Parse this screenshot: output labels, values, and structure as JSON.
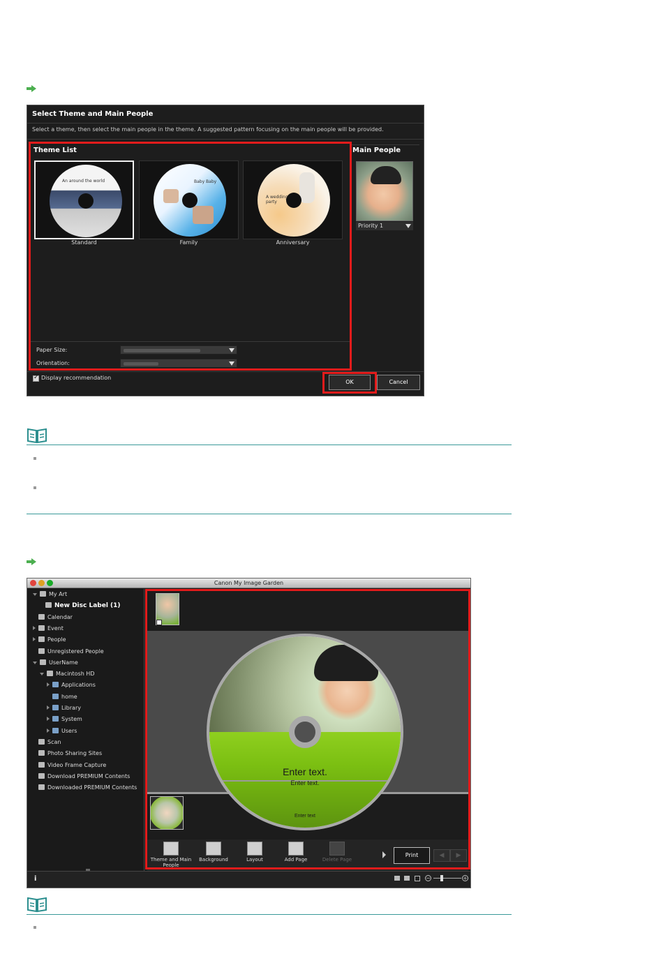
{
  "dialog": {
    "title": "Select Theme and Main People",
    "instruction": "Select a theme, then select the main people in the theme. A suggested pattern focusing on the main people will be provided.",
    "theme_list_label": "Theme List",
    "themes": [
      {
        "name": "Standard",
        "disc_text": "An around the world",
        "selected": true
      },
      {
        "name": "Family",
        "disc_text": "Baby Baby",
        "selected": false
      },
      {
        "name": "Anniversary",
        "disc_text": "A wedding party",
        "selected": false
      }
    ],
    "main_people_label": "Main People",
    "priority": "Priority 1",
    "paper_size_label": "Paper Size:",
    "orientation_label": "Orientation:",
    "display_recommendation": "Display recommendation",
    "ok_label": "OK",
    "cancel_label": "Cancel"
  },
  "app": {
    "window_title": "Canon My Image Garden",
    "sidebar": [
      {
        "label": "My Art",
        "level": 0,
        "expand": "down",
        "icon": "art-icon"
      },
      {
        "label": "New Disc Label (1)",
        "level": 1,
        "expand": "none",
        "icon": "disc-label-icon",
        "bold": true
      },
      {
        "label": "Calendar",
        "level": 0,
        "expand": "none",
        "icon": "calendar-icon"
      },
      {
        "label": "Event",
        "level": 0,
        "expand": "right",
        "icon": "event-icon"
      },
      {
        "label": "People",
        "level": 0,
        "expand": "right",
        "icon": "people-icon"
      },
      {
        "label": "Unregistered People",
        "level": 0,
        "expand": "none",
        "icon": "person-icon"
      },
      {
        "label": "UserName",
        "level": 0,
        "expand": "down",
        "icon": "computer-icon"
      },
      {
        "label": "Macintosh HD",
        "level": 1,
        "expand": "down",
        "icon": "drive-icon"
      },
      {
        "label": "Applications",
        "level": 2,
        "expand": "right",
        "icon": "folder-icon"
      },
      {
        "label": "home",
        "level": 2,
        "expand": "none",
        "icon": "folder-icon"
      },
      {
        "label": "Library",
        "level": 2,
        "expand": "right",
        "icon": "folder-icon"
      },
      {
        "label": "System",
        "level": 2,
        "expand": "right",
        "icon": "folder-icon"
      },
      {
        "label": "Users",
        "level": 2,
        "expand": "right",
        "icon": "folder-icon"
      },
      {
        "label": "Scan",
        "level": 0,
        "expand": "none",
        "icon": "scan-icon"
      },
      {
        "label": "Photo Sharing Sites",
        "level": 0,
        "expand": "none",
        "icon": "photo-sharing-icon"
      },
      {
        "label": "Video Frame Capture",
        "level": 0,
        "expand": "none",
        "icon": "video-icon"
      },
      {
        "label": "Download PREMIUM Contents",
        "level": 0,
        "expand": "none",
        "icon": "download-icon"
      },
      {
        "label": "Downloaded PREMIUM Contents",
        "level": 0,
        "expand": "none",
        "icon": "downloaded-icon"
      }
    ],
    "disc_text_large": "Enter text.",
    "disc_text_small": "Enter text.",
    "disc_text_bottom": "Enter text",
    "toolbar": [
      {
        "label": "Theme and Main People",
        "icon": "theme-people-icon",
        "enabled": true
      },
      {
        "label": "Background",
        "icon": "background-icon",
        "enabled": true
      },
      {
        "label": "Layout",
        "icon": "layout-icon",
        "enabled": true
      },
      {
        "label": "Add Page",
        "icon": "add-page-icon",
        "enabled": true
      },
      {
        "label": "Delete Page",
        "icon": "delete-page-icon",
        "enabled": false
      }
    ],
    "print_label": "Print",
    "info_label": "i"
  },
  "colors": {
    "highlight": "#e21b1b",
    "note_line": "#3a9a9a",
    "step_arrow": "#4caf50"
  }
}
